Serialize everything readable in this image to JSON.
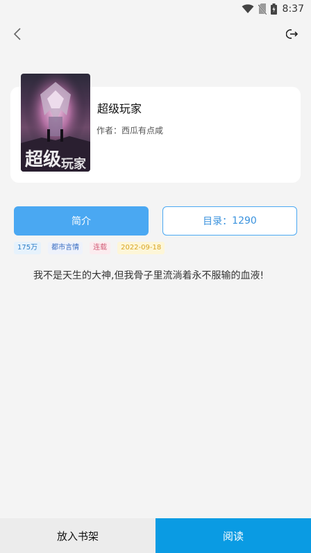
{
  "status_bar": {
    "time": "8:37",
    "icons": [
      "wifi-icon",
      "no-sim-icon",
      "battery-icon"
    ]
  },
  "nav": {
    "back_icon": "chevron-left-icon",
    "share_icon": "exit-share-icon"
  },
  "book": {
    "title": "超级玩家",
    "author_label": "作者：",
    "author": "西瓜有点咸",
    "cover_icon": "book-cover-image"
  },
  "tabs": {
    "intro": "简介",
    "toc_label": "目录：",
    "toc_count": "1290"
  },
  "tags": {
    "count": "175万",
    "genre": "都市言情",
    "status": "连载",
    "date": "2022-09-18"
  },
  "intro_text": "我不是天生的大神,但我骨子里流淌着永不服输的血液!",
  "bottom": {
    "shelf": "放入书架",
    "read": "阅读"
  },
  "colors": {
    "accent": "#4aa8f2",
    "read_button": "#0a9be3"
  }
}
